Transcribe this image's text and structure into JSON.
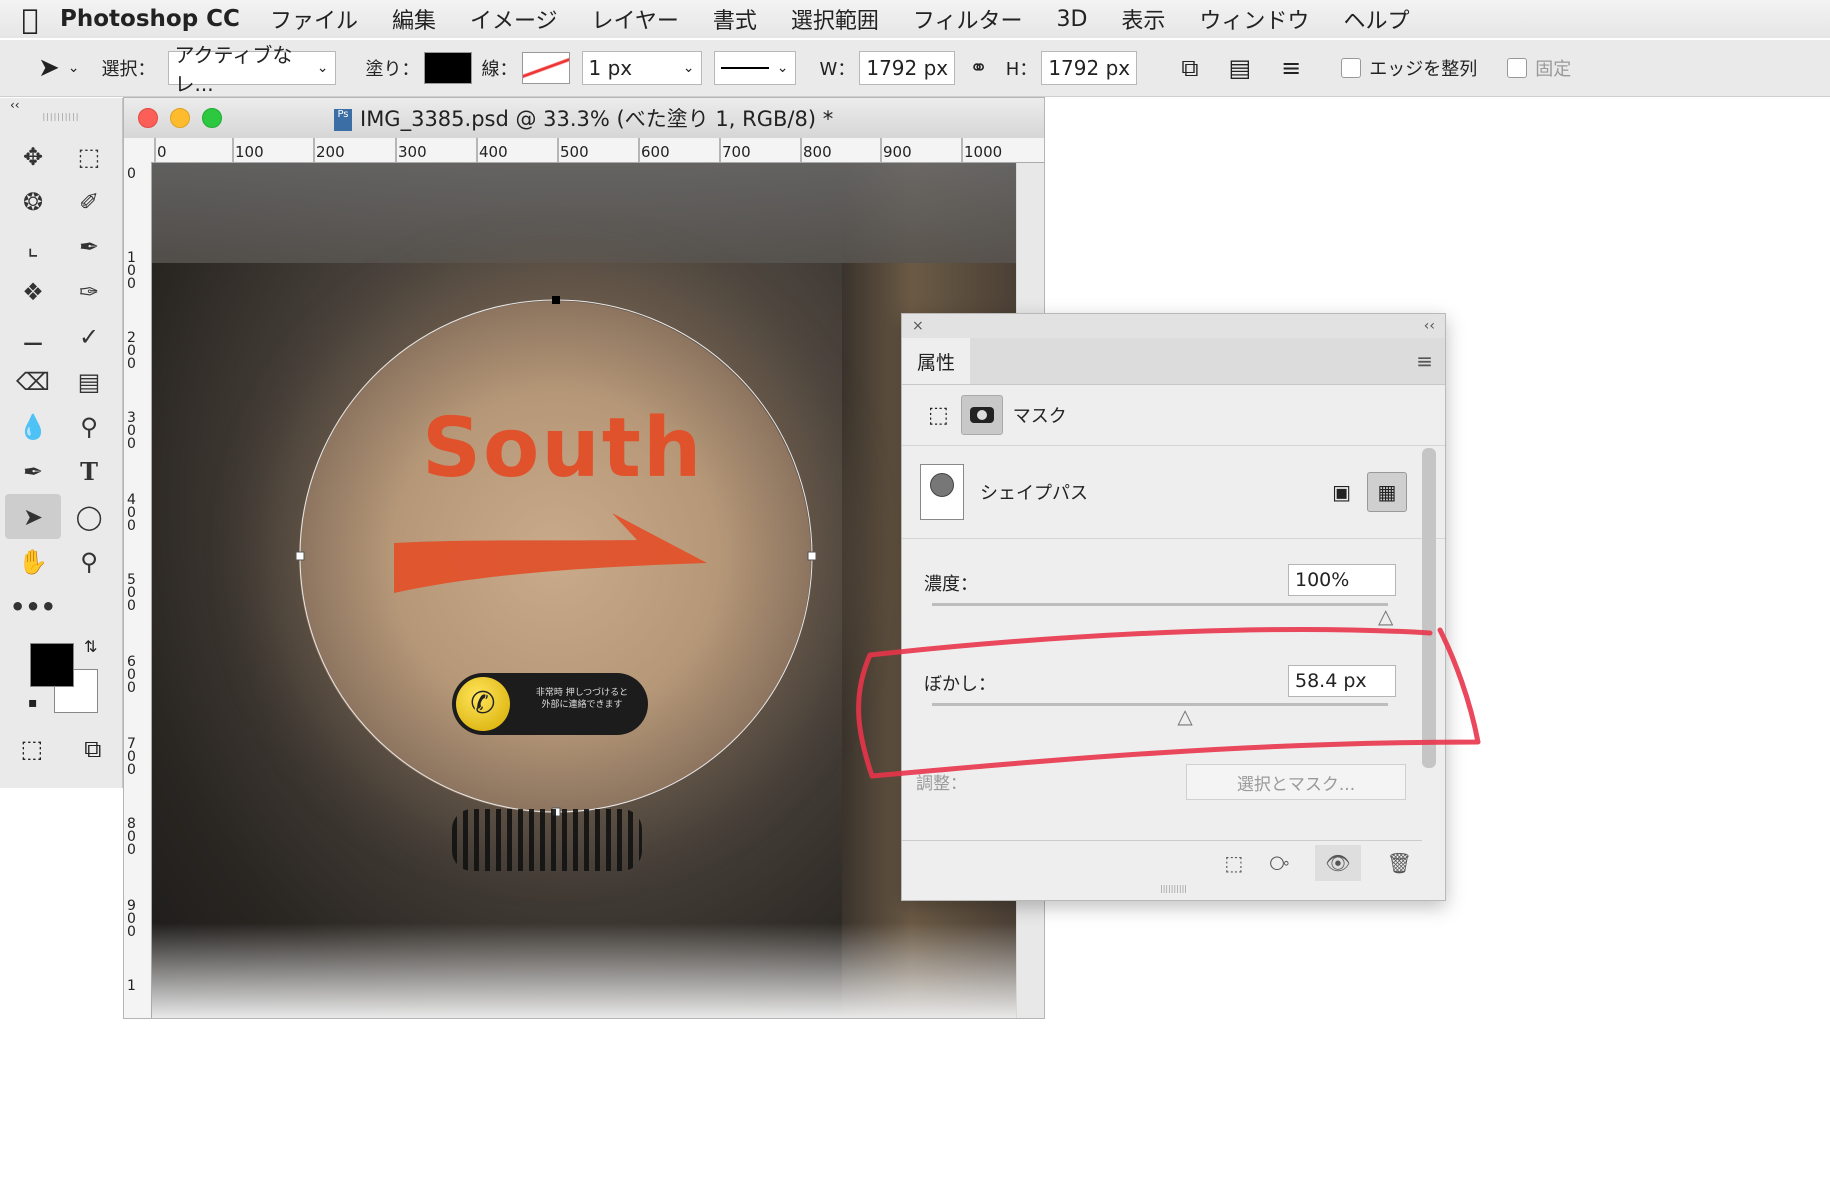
{
  "menubar": {
    "apple_icon": "apple-icon",
    "app_name": "Photoshop CC",
    "items": [
      "ファイル",
      "編集",
      "イメージ",
      "レイヤー",
      "書式",
      "選択範囲",
      "フィルター",
      "3D",
      "表示",
      "ウィンドウ",
      "ヘルプ"
    ]
  },
  "options_bar": {
    "select_label": "選択：",
    "select_value": "アクティブなレ...",
    "fill_label": "塗り：",
    "stroke_label": "線：",
    "stroke_width": "1 px",
    "w_label": "W：",
    "w_value": "1792 px",
    "h_label": "H：",
    "h_value": "1792 px",
    "align_edges_label": "エッジを整列",
    "constrain_label": "固定"
  },
  "tools": {
    "collapse": "‹‹",
    "more": "•••"
  },
  "document": {
    "title": "IMG_3385.psd @ 33.3% (べた塗り 1, RGB/8) *",
    "h_ruler": [
      "0",
      "100",
      "200",
      "300",
      "400",
      "500",
      "600",
      "700",
      "800",
      "900",
      "1000"
    ],
    "v_ruler": [
      "0",
      "100",
      "200",
      "300",
      "400",
      "500",
      "600",
      "700",
      "800",
      "900",
      "1"
    ],
    "canvas_sign_text": "South",
    "emergency_line1": "非常時 押しつづけると",
    "emergency_line2": "外部に連絡できます"
  },
  "properties_panel": {
    "close": "×",
    "collapse": "‹‹",
    "tab": "属性",
    "mask_label": "マスク",
    "shape_path_label": "シェイプパス",
    "density_label": "濃度：",
    "density_value": "100%",
    "density_level": 1.0,
    "feather_label": "ぼかし：",
    "feather_value": "58.4 px",
    "feather_level": 0.56,
    "adjust_label": "調整：",
    "select_mask_button": "選択とマスク..."
  },
  "colors": {
    "highlight_stroke": "#e8344a",
    "sign_orange": "#e0522b"
  }
}
